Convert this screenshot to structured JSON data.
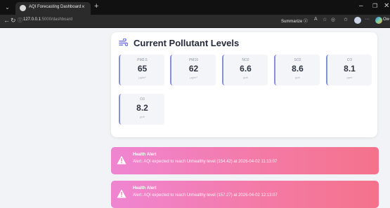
{
  "browser": {
    "tab_title": "AQI Forecasting Dashboard",
    "tab_close": "×",
    "new_tab": "+",
    "url_host": "127.0.0.1",
    "url_path": ":5000/dashboard",
    "summarize_label": "Summarize",
    "profile_chat_label": "Ow",
    "window": {
      "minimize": "–",
      "maximize": "❐",
      "close": "✕"
    },
    "icons": [
      "sidebar-toggle-icon",
      "back-icon",
      "reload-icon",
      "site-info-icon",
      "read-aloud-icon",
      "favorites-star-icon",
      "extensions-icon",
      "favorites-icon",
      "profile-icon",
      "more-icon",
      "copilot-icon"
    ]
  },
  "pollutants": {
    "title": "Current Pollutant Levels",
    "items": [
      {
        "name": "PM2.5",
        "value": "65",
        "unit": "μg/m³"
      },
      {
        "name": "PM10",
        "value": "62",
        "unit": "μg/m³"
      },
      {
        "name": "NO2",
        "value": "6.6",
        "unit": "ppb"
      },
      {
        "name": "SO2",
        "value": "8.6",
        "unit": "ppb"
      },
      {
        "name": "CO",
        "value": "8.1",
        "unit": "ppm"
      },
      {
        "name": "O3",
        "value": "8.2",
        "unit": "ppb"
      }
    ]
  },
  "alerts": [
    {
      "title": "Health Alert",
      "message": "Alert: AQI expected to reach Unhealthy level (154.42) at 2026-04-02 11:13:07"
    },
    {
      "title": "Health Alert",
      "message": "Alert: AQI expected to reach Unhealthy level (157.27) at 2026-04-02 12:13:07"
    }
  ],
  "colors": {
    "accent": "#8590d8",
    "alert_gradient_start": "#ef85d2",
    "alert_gradient_end": "#f4728b",
    "page_background": "#f1f3f6"
  }
}
